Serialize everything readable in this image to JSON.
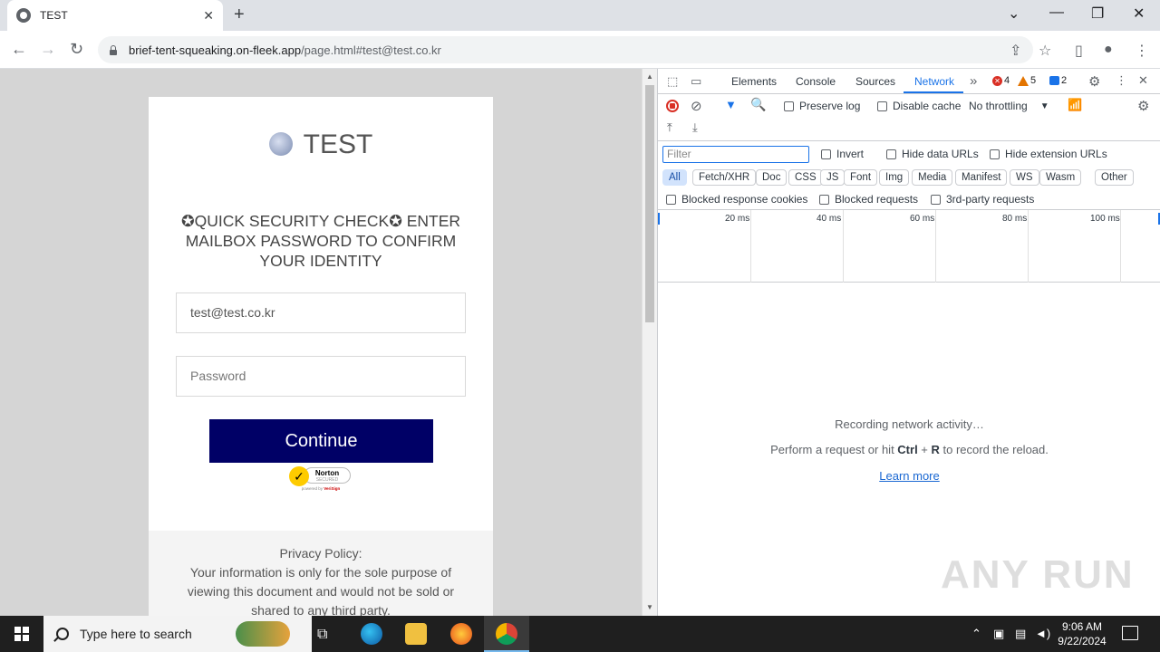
{
  "browser": {
    "tab_title": "TEST",
    "tab_close": "✕",
    "new_tab": "+",
    "url_host": "brief-tent-squeaking.on-fleek.app",
    "url_path": "/page.html#test@test.co.kr",
    "icons": {
      "back": "←",
      "forward": "→",
      "reload": "↻",
      "share": "⇪",
      "star": "☆",
      "sidepanel": "▯",
      "profile": "●",
      "menu": "⋮",
      "minimize": "—",
      "restore": "❐",
      "close": "✕",
      "tab_list": "⌄"
    }
  },
  "page": {
    "brand": "TEST",
    "headline": "✪QUICK SECURITY CHECK✪ ENTER MAILBOX PASSWORD TO CONFIRM YOUR IDENTITY",
    "email_value": "test@test.co.kr",
    "password_placeholder": "Password",
    "continue_label": "Continue",
    "norton": {
      "name": "Norton",
      "sub": "SECURED",
      "by_prefix": "powered by",
      "by_brand": "VeriSign",
      "check": "✓"
    },
    "policy_title": "Privacy Policy:",
    "policy_text": "Your information is only for the sole purpose of viewing this document and would not be sold or shared to any third party."
  },
  "devtools": {
    "tabs": [
      "Elements",
      "Console",
      "Sources",
      "Network"
    ],
    "active_tab": "Network",
    "more": "»",
    "errors": "4",
    "warnings": "5",
    "info": "2",
    "preserve_log": "Preserve log",
    "disable_cache": "Disable cache",
    "throttling": "No throttling",
    "filter_placeholder": "Filter",
    "invert": "Invert",
    "hide_data_urls": "Hide data URLs",
    "hide_extension_urls": "Hide extension URLs",
    "types": [
      "All",
      "Fetch/XHR",
      "Doc",
      "CSS",
      "JS",
      "Font",
      "Img",
      "Media",
      "Manifest",
      "WS",
      "Wasm",
      "Other"
    ],
    "active_type": "All",
    "blocked_response_cookies": "Blocked response cookies",
    "blocked_requests": "Blocked requests",
    "third_party": "3rd-party requests",
    "timeline_labels": [
      "20 ms",
      "40 ms",
      "60 ms",
      "80 ms",
      "100 ms"
    ],
    "recording": "Recording network activity…",
    "perform_prefix": "Perform a request or hit ",
    "ctrl": "Ctrl",
    "plus": " + ",
    "r_key": "R",
    "perform_suffix": " to record the reload.",
    "learn_more": "Learn more"
  },
  "watermark": "ANY RUN",
  "taskbar": {
    "search_placeholder": "Type here to search",
    "time": "9:06 AM",
    "date": "9/22/2024"
  },
  "colors": {
    "continue_bg": "#000066",
    "devtools_accent": "#1a73e8",
    "taskbar": "#1f1f1f"
  }
}
